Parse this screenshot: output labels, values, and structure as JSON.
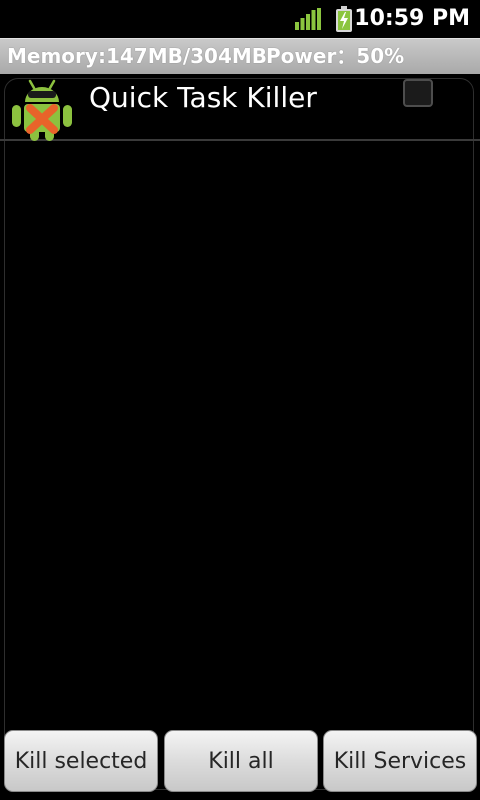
{
  "status_bar": {
    "time": "10:59 PM",
    "icons": [
      "signal-icon",
      "battery-charging-icon"
    ]
  },
  "info_strip": {
    "memory": "Memory:147MB/304MB",
    "power": "Power：50%"
  },
  "header": {
    "title": "Quick Task Killer",
    "icon": "android-killer-icon",
    "select_all_checked": false
  },
  "buttons": {
    "kill_selected": "Kill selected",
    "kill_all": "Kill all",
    "kill_services": "Kill Services"
  },
  "colors": {
    "signal": "#8bc53f",
    "battery": "#8bc53f",
    "android_green": "#8cc13f",
    "kill_x": "#e8632a"
  }
}
